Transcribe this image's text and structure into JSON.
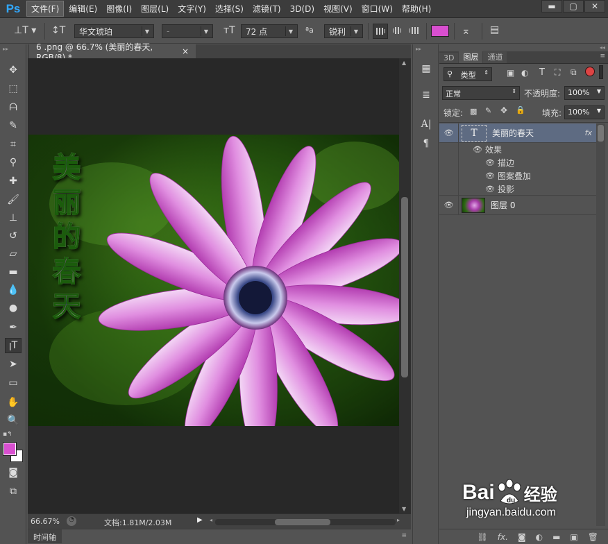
{
  "app": {
    "logo": "Ps",
    "menus": [
      "文件(F)",
      "编辑(E)",
      "图像(I)",
      "图层(L)",
      "文字(Y)",
      "选择(S)",
      "滤镜(T)",
      "3D(D)",
      "视图(V)",
      "窗口(W)",
      "帮助(H)"
    ],
    "window_controls": [
      "▬",
      "▢",
      "✕"
    ]
  },
  "options": {
    "font_family": "华文琥珀",
    "font_style": "-",
    "font_size": "72 点",
    "antialias": "锐利",
    "text_color": "#d94fd0"
  },
  "document": {
    "tab_title": "6 .png @ 66.7% (美丽的春天, RGB/8) *",
    "tab_close": "×",
    "zoom": "66.67%",
    "doc_info": "文档:1.81M/2.03M",
    "timeline_label": "时间轴",
    "vertical_text": [
      "美",
      "丽",
      "的",
      "春",
      "天"
    ]
  },
  "colors": {
    "foreground": "#d94fd0",
    "background": "#ffffff"
  },
  "layers_panel": {
    "tabs": [
      "3D",
      "图层",
      "通道"
    ],
    "filter_kind": "类型",
    "blend_mode": "正常",
    "opacity_label": "不透明度:",
    "opacity_value": "100%",
    "lock_label": "锁定:",
    "fill_label": "填充:",
    "fill_value": "100%",
    "text_layer_name": "美丽的春天",
    "fx_badge": "fx",
    "effects_label": "效果",
    "effects": [
      "描边",
      "图案叠加",
      "投影"
    ],
    "image_layer_name": "图层 0"
  },
  "watermark": {
    "brand": "Bai",
    "brand_suffix": "经验",
    "url": "jingyan.baidu.com"
  }
}
